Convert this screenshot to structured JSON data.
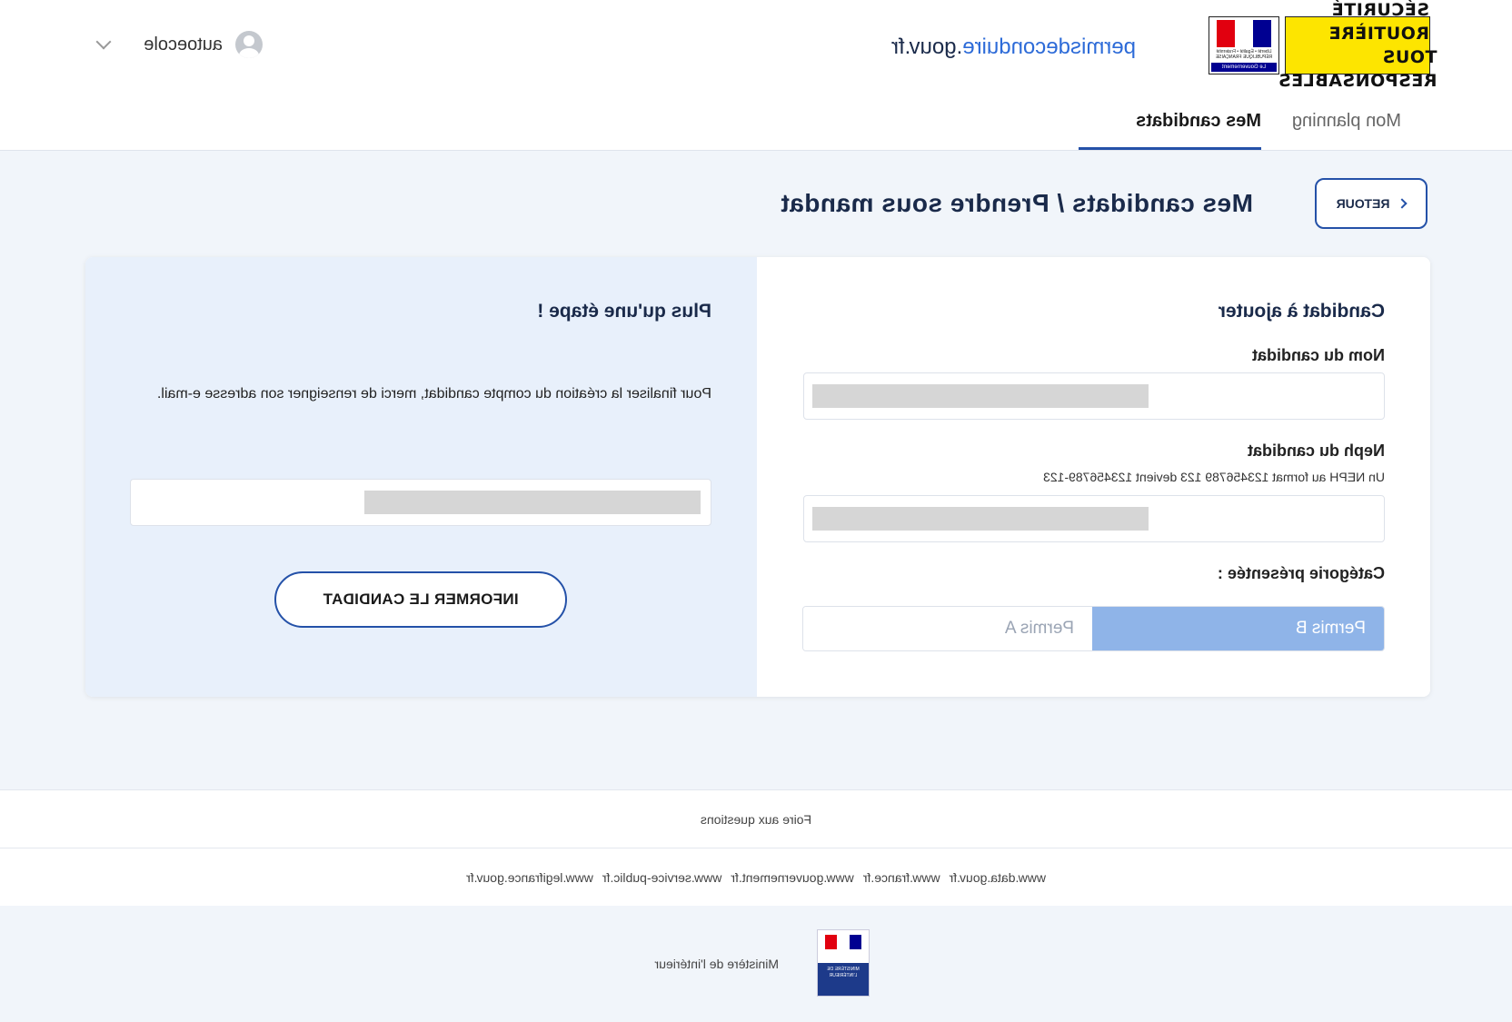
{
  "header": {
    "logo_sr_line1": "SÉCURITÉ ROUTIÈRE",
    "logo_sr_line2": "TOUS RESPONSABLES",
    "logo_rf_text": "Liberté • Égalité • Fraternité RÉPUBLIQUE FRANÇAISE",
    "logo_rf_band": "Le Gouvernement",
    "site_name_accent": "permisdeconduire",
    "site_name_rest": ".gouv.fr",
    "user_name": "autoecole"
  },
  "tabs": {
    "planning": "Mon planning",
    "candidats": "Mes candidats"
  },
  "main": {
    "back_label": "RETOUR",
    "page_title": "Mes candidats / Prendre sous mandat",
    "left": {
      "section_title": "Candidat à ajouter",
      "nom_label": "Nom du candidat",
      "neph_label": "Neph du candidat",
      "neph_hint": "Un NEPH au format 123456789 123 devient 123456789-123",
      "categorie_label": "Catégorie présentée :",
      "categories": [
        "Permis A",
        "Permis B"
      ],
      "selected_category": "Permis B"
    },
    "right": {
      "section_title": "Plus qu'une étape !",
      "info_text": "Pour finaliser la création du compte candidat, merci de renseigner son adresse e-mail.",
      "inform_button": "INFORMER LE CANDIDAT"
    }
  },
  "footer": {
    "faq": "Foire aux questions",
    "links": [
      "www.legifrance.gouv.fr",
      "www.service-public.fr",
      "www.gouvernement.fr",
      "www.france.fr",
      "www.data.gouv.fr"
    ],
    "ministry": "Ministère de l'intérieur",
    "ministry_logo_text": "MINISTÈRE DE L'INTÉRIEUR"
  },
  "colors": {
    "primary": "#2451a8",
    "toggle_selected": "#8fb4e8",
    "background": "#f1f5fa",
    "panel_right": "#e8f0fb"
  }
}
